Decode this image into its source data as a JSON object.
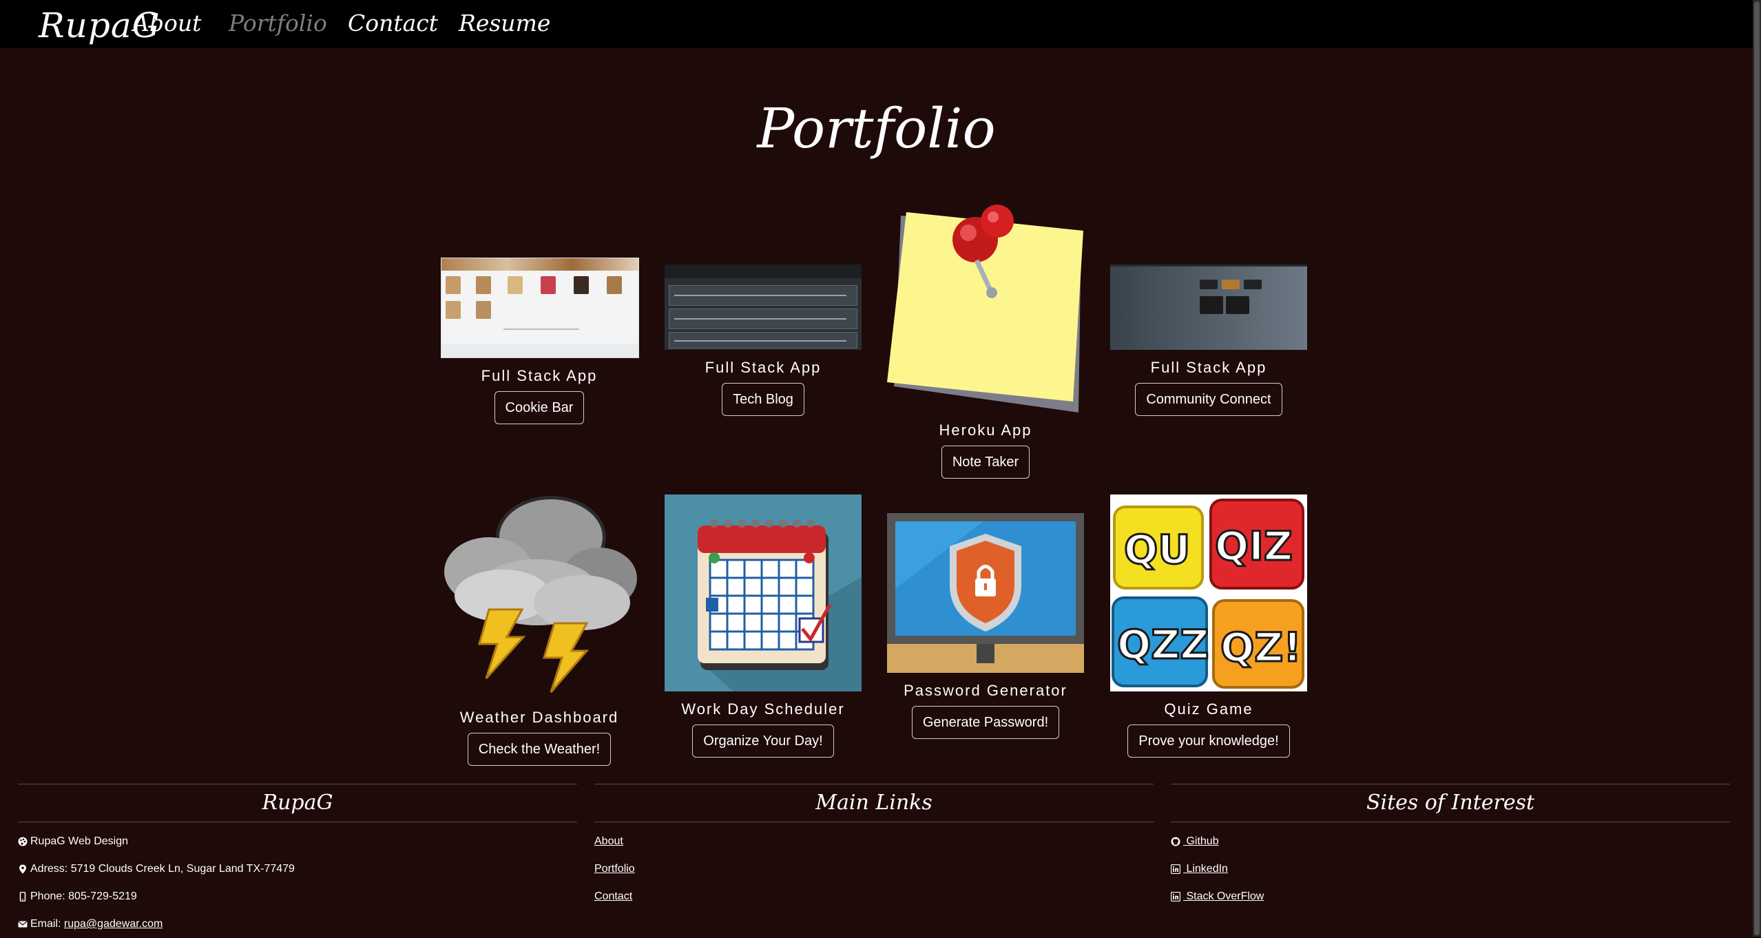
{
  "nav": {
    "brand": "RupaG",
    "links": [
      "About",
      "Portfolio",
      "Contact",
      "Resume"
    ]
  },
  "page_title": "Portfolio",
  "cards": [
    {
      "title": "Full Stack App",
      "button": "Cookie Bar",
      "icon": "cookie-bar-screenshot"
    },
    {
      "title": "Full Stack App",
      "button": "Tech Blog",
      "icon": "tech-blog-screenshot"
    },
    {
      "title": "Heroku App",
      "button": "Note Taker",
      "icon": "sticky-note-pin-icon"
    },
    {
      "title": "Full Stack App",
      "button": "Community Connect",
      "icon": "community-connect-screenshot"
    },
    {
      "title": "Weather Dashboard",
      "button": "Check the Weather!",
      "icon": "storm-cloud-icon"
    },
    {
      "title": "Work Day Scheduler",
      "button": "Organize Your Day!",
      "icon": "calendar-icon"
    },
    {
      "title": "Password Generator",
      "button": "Generate Password!",
      "icon": "security-shield-icon"
    },
    {
      "title": "Quiz Game",
      "button": "Prove your knowledge!",
      "icon": "quiz-tiles-icon"
    }
  ],
  "thumb_text": {
    "quiz_tiles": [
      "QU",
      "QIZ",
      "QZZ",
      "QZ!"
    ]
  },
  "footer": {
    "col1": {
      "heading": "RupaG",
      "items": [
        {
          "icon": "palette-icon",
          "text": "RupaG Web Design"
        },
        {
          "icon": "map-pin-icon",
          "text": "Adress: 5719 Clouds Creek Ln, Sugar Land TX-77479"
        },
        {
          "icon": "phone-icon",
          "text": "Phone: 805-729-5219"
        },
        {
          "icon": "envelope-icon",
          "text": "Email: ",
          "link": "rupa@gadewar.com"
        }
      ]
    },
    "col2": {
      "heading": "Main Links",
      "links": [
        "About",
        "Portfolio",
        "Contact"
      ]
    },
    "col3": {
      "heading": "Sites of Interest",
      "links": [
        {
          "icon": "github-icon",
          "text": " Github"
        },
        {
          "icon": "linkedin-icon",
          "text": " LinkedIn"
        },
        {
          "icon": "linkedin-icon",
          "text": " Stack OverFlow"
        }
      ]
    }
  },
  "colors": {
    "background": "#1d0a09",
    "nav": "#000000",
    "active_link": "#7e7e7e"
  }
}
